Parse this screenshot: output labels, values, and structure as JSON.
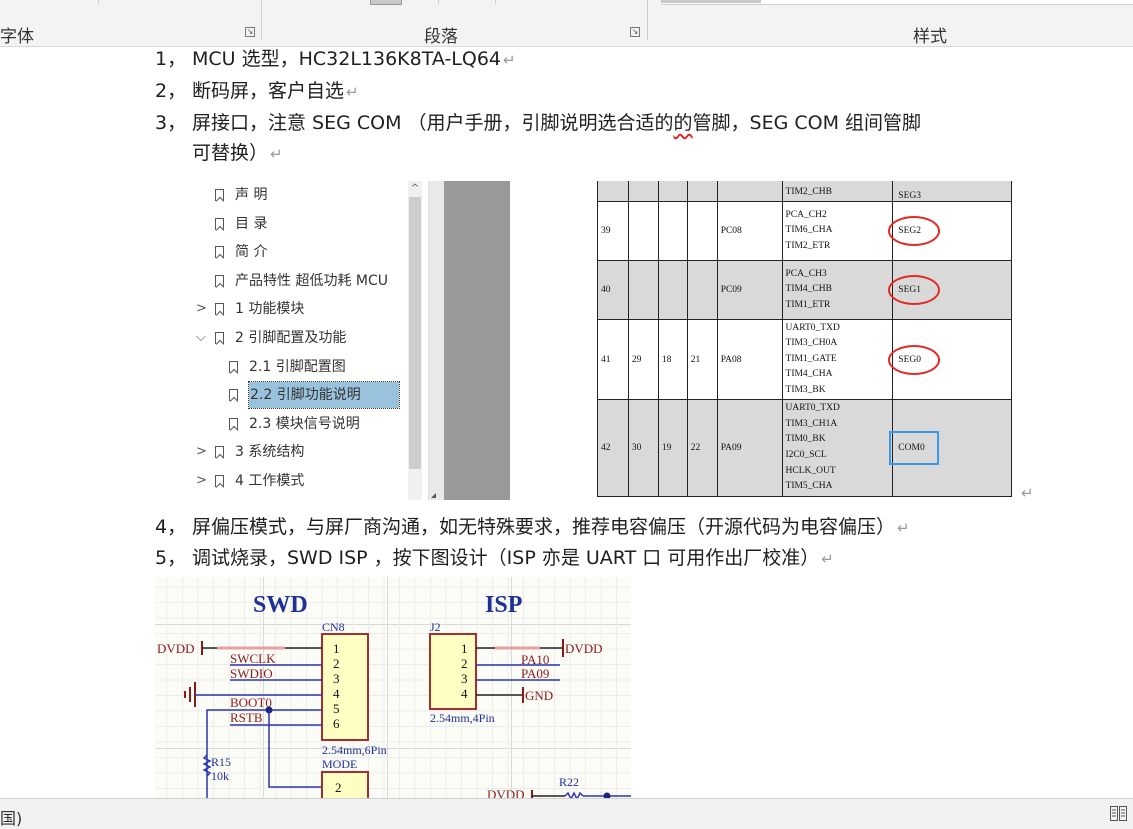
{
  "ribbon": {
    "groups": [
      {
        "label": "字体",
        "launcher": true
      },
      {
        "label": "段落",
        "launcher": true
      },
      {
        "label": "样式",
        "launcher": false
      }
    ],
    "launcher_glyph": "↘"
  },
  "document": {
    "items": [
      {
        "num": "1，",
        "text": "MCU 选型，HC32L136K8TA-LQ64"
      },
      {
        "num": "2，",
        "text": "断码屏，客户自选"
      },
      {
        "num": "3，",
        "text_before": "屏接口，注意 SEG COM （用户手册，引脚说明选合适的",
        "squiggle": "的",
        "text_after": "管脚，SEG COM  组间管脚",
        "continuation": "可替换）"
      },
      {
        "num": "4，",
        "text": "屏偏压模式，与屏厂商沟通，如无特殊要求，推荐电容偏压（开源代码为电容偏压）"
      },
      {
        "num": "5，",
        "text": "调试烧录，SWD ISP ，按下图设计（ISP  亦是 UART 口  可用作出厂校准）"
      }
    ],
    "paragraph_mark": "↵"
  },
  "bookmark_panel": {
    "items": [
      {
        "label": "声 明",
        "level": 0,
        "expander": ""
      },
      {
        "label": "目 录",
        "level": 0,
        "expander": ""
      },
      {
        "label": "简 介",
        "level": 0,
        "expander": ""
      },
      {
        "label": "产品特性 超低功耗 MCU",
        "level": 0,
        "expander": ""
      },
      {
        "label": "1 功能模块",
        "level": 0,
        "expander": "›"
      },
      {
        "label": "2 引脚配置及功能",
        "level": 0,
        "expander": "⌄"
      },
      {
        "label": "2.1 引脚配置图",
        "level": 1,
        "expander": ""
      },
      {
        "label": "2.2  引脚功能说明",
        "level": 1,
        "expander": "",
        "selected": true
      },
      {
        "label": "2.3 模块信号说明",
        "level": 1,
        "expander": ""
      },
      {
        "label": "3 系统结构",
        "level": 0,
        "expander": "›"
      },
      {
        "label": "4  工作模式",
        "level": 0,
        "expander": "›"
      }
    ],
    "scroll_up_glyph": "^"
  },
  "pin_table": {
    "rows": [
      {
        "cols": [
          "",
          "",
          "",
          "",
          ""
        ],
        "funcs": [
          "TIM2_CHB"
        ],
        "analog": "SEG3",
        "shaded": true,
        "highlight": ""
      },
      {
        "cols": [
          "39",
          "",
          "",
          "",
          "PC08"
        ],
        "funcs": [
          "PCA_CH2",
          "TIM6_CHA",
          "TIM2_ETR"
        ],
        "analog": "SEG2",
        "shaded": false,
        "highlight": "red"
      },
      {
        "cols": [
          "40",
          "",
          "",
          "",
          "PC09"
        ],
        "funcs": [
          "PCA_CH3",
          "TIM4_CHB",
          "TIM1_ETR"
        ],
        "analog": "SEG1",
        "shaded": true,
        "highlight": "red"
      },
      {
        "cols": [
          "41",
          "29",
          "18",
          "21",
          "PA08"
        ],
        "funcs": [
          "UART0_TXD",
          "TIM3_CH0A",
          "TIM1_GATE",
          "TIM4_CHA",
          "TIM3_BK"
        ],
        "analog": "SEG0",
        "shaded": false,
        "highlight": "red"
      },
      {
        "cols": [
          "42",
          "30",
          "19",
          "22",
          "PA09"
        ],
        "funcs": [
          "UART0_TXD",
          "TIM3_CH1A",
          "TIM0_BK",
          "I2C0_SCL",
          "HCLK_OUT",
          "TIM5_CHA"
        ],
        "analog": "COM0",
        "shaded": true,
        "highlight": "blue"
      }
    ]
  },
  "schematic": {
    "swd": {
      "title": "SWD",
      "ref": "CN8",
      "pins": [
        "1",
        "2",
        "3",
        "4",
        "5",
        "6"
      ],
      "nets": {
        "power": "DVDD",
        "swclk": "SWCLK",
        "swdio": "SWDIO",
        "boot": "BOOT0",
        "rst": "RSTB"
      },
      "footprint": "2.54mm,6Pin",
      "mode_ref": "MODE",
      "mode_pins": [
        "2"
      ],
      "resistor": {
        "ref": "R15",
        "value": "10k"
      }
    },
    "isp": {
      "title": "ISP",
      "ref": "J2",
      "pins": [
        "1",
        "2",
        "3",
        "4"
      ],
      "nets": {
        "power": "DVDD",
        "pa10": "PA10",
        "pa09": "PA09",
        "gnd": "GND"
      },
      "footprint": "2.54mm,4Pin"
    },
    "r22": {
      "ref": "R22",
      "net": "DVDD"
    },
    "colors": {
      "title": "#1f2f9a",
      "net_label": "#8b1a1a",
      "wire": "#2a35b0",
      "connector_fill": "#ffffc4",
      "connector_border": "#a33030"
    }
  },
  "statusbar": {
    "left_text": "国)",
    "read_mode_icon": "read-mode"
  }
}
